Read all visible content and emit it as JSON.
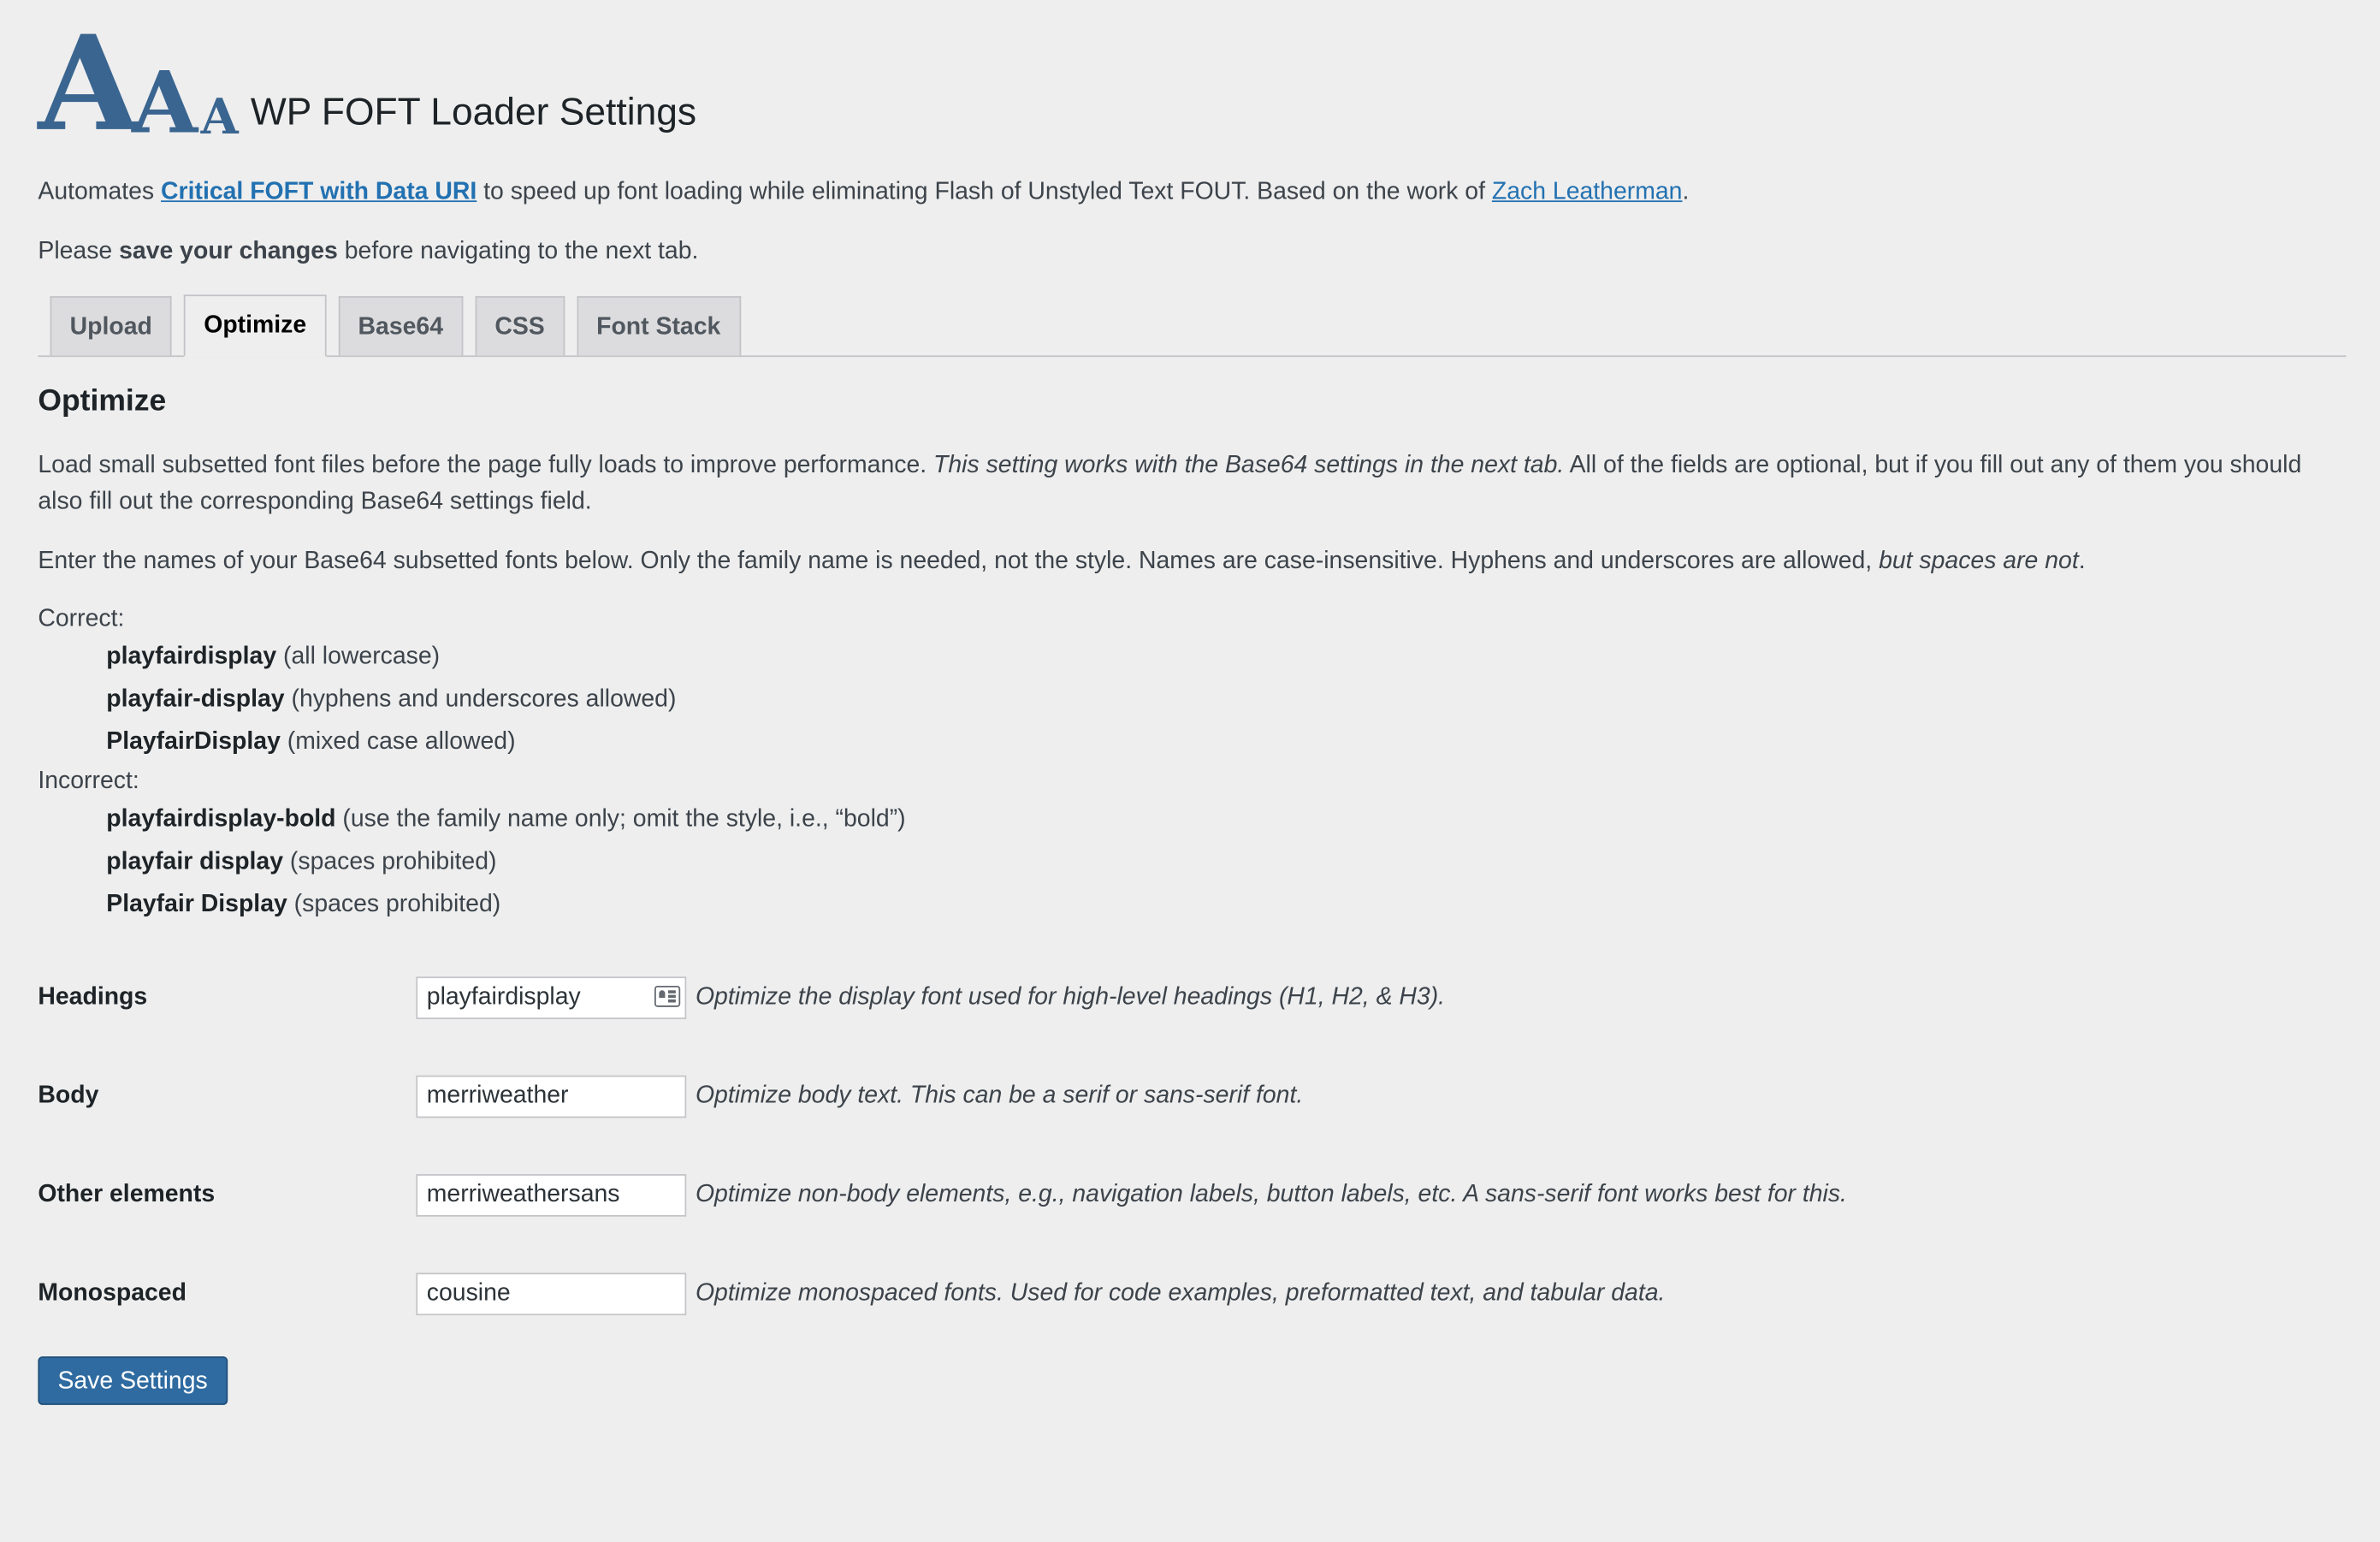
{
  "header": {
    "logo_letters": [
      "A",
      "A",
      "A"
    ],
    "title": "WP FOFT Loader Settings"
  },
  "intro": {
    "text_before": "Automates ",
    "link1": "Critical FOFT with Data URI",
    "text_mid": " to speed up font loading while eliminating Flash of Unstyled Text FOUT. Based on the work of ",
    "link2": "Zach Leatherman",
    "text_after": "."
  },
  "save_note": {
    "before": "Please ",
    "bold": "save your changes",
    "after": " before navigating to the next tab."
  },
  "tabs": [
    {
      "label": "Upload",
      "active": false
    },
    {
      "label": "Optimize",
      "active": true
    },
    {
      "label": "Base64",
      "active": false
    },
    {
      "label": "CSS",
      "active": false
    },
    {
      "label": "Font Stack",
      "active": false
    }
  ],
  "section": {
    "heading": "Optimize",
    "desc1_before": "Load small subsetted font files before the page fully loads to improve performance. ",
    "desc1_italic": "This setting works with the Base64 settings in the next tab.",
    "desc1_after": " All of the fields are optional, but if you fill out any of them you should also fill out the corresponding Base64 settings field.",
    "desc2_before": "Enter the names of your Base64 subsetted fonts below. Only the family name is needed, not the style. Names are case-insensitive. Hyphens and underscores are allowed, ",
    "desc2_italic": "but spaces are not",
    "desc2_after": "."
  },
  "examples": {
    "correct_label": "Correct:",
    "correct": [
      {
        "name": "playfairdisplay",
        "note": " (all lowercase)"
      },
      {
        "name": "playfair-display",
        "note": " (hyphens and underscores allowed)"
      },
      {
        "name": "PlayfairDisplay",
        "note": " (mixed case allowed)"
      }
    ],
    "incorrect_label": "Incorrect:",
    "incorrect": [
      {
        "name": "playfairdisplay-bold",
        "note": " (use the family name only; omit the style, i.e., “bold”)"
      },
      {
        "name": "playfair display",
        "note": " (spaces prohibited)"
      },
      {
        "name": "Playfair Display",
        "note": " (spaces prohibited)"
      }
    ]
  },
  "fields": [
    {
      "label": "Headings",
      "value": "playfairdisplay",
      "icon": "contact-card-icon",
      "help": "Optimize the display font used for high-level headings (H1, H2, & H3)."
    },
    {
      "label": "Body",
      "value": "merriweather",
      "help": "Optimize body text. This can be a serif or sans-serif font."
    },
    {
      "label": "Other elements",
      "value": "merriweathersans",
      "help": "Optimize non-body elements, e.g., navigation labels, button labels, etc. A sans-serif font works best for this."
    },
    {
      "label": "Monospaced",
      "value": "cousine",
      "help": "Optimize monospaced fonts. Used for code examples, preformatted text, and tabular data."
    }
  ],
  "save_button": "Save Settings",
  "colors": {
    "background": "#eeeeee",
    "accent": "#2f6ba0",
    "logo": "#3a6590",
    "link": "#2271b1"
  }
}
